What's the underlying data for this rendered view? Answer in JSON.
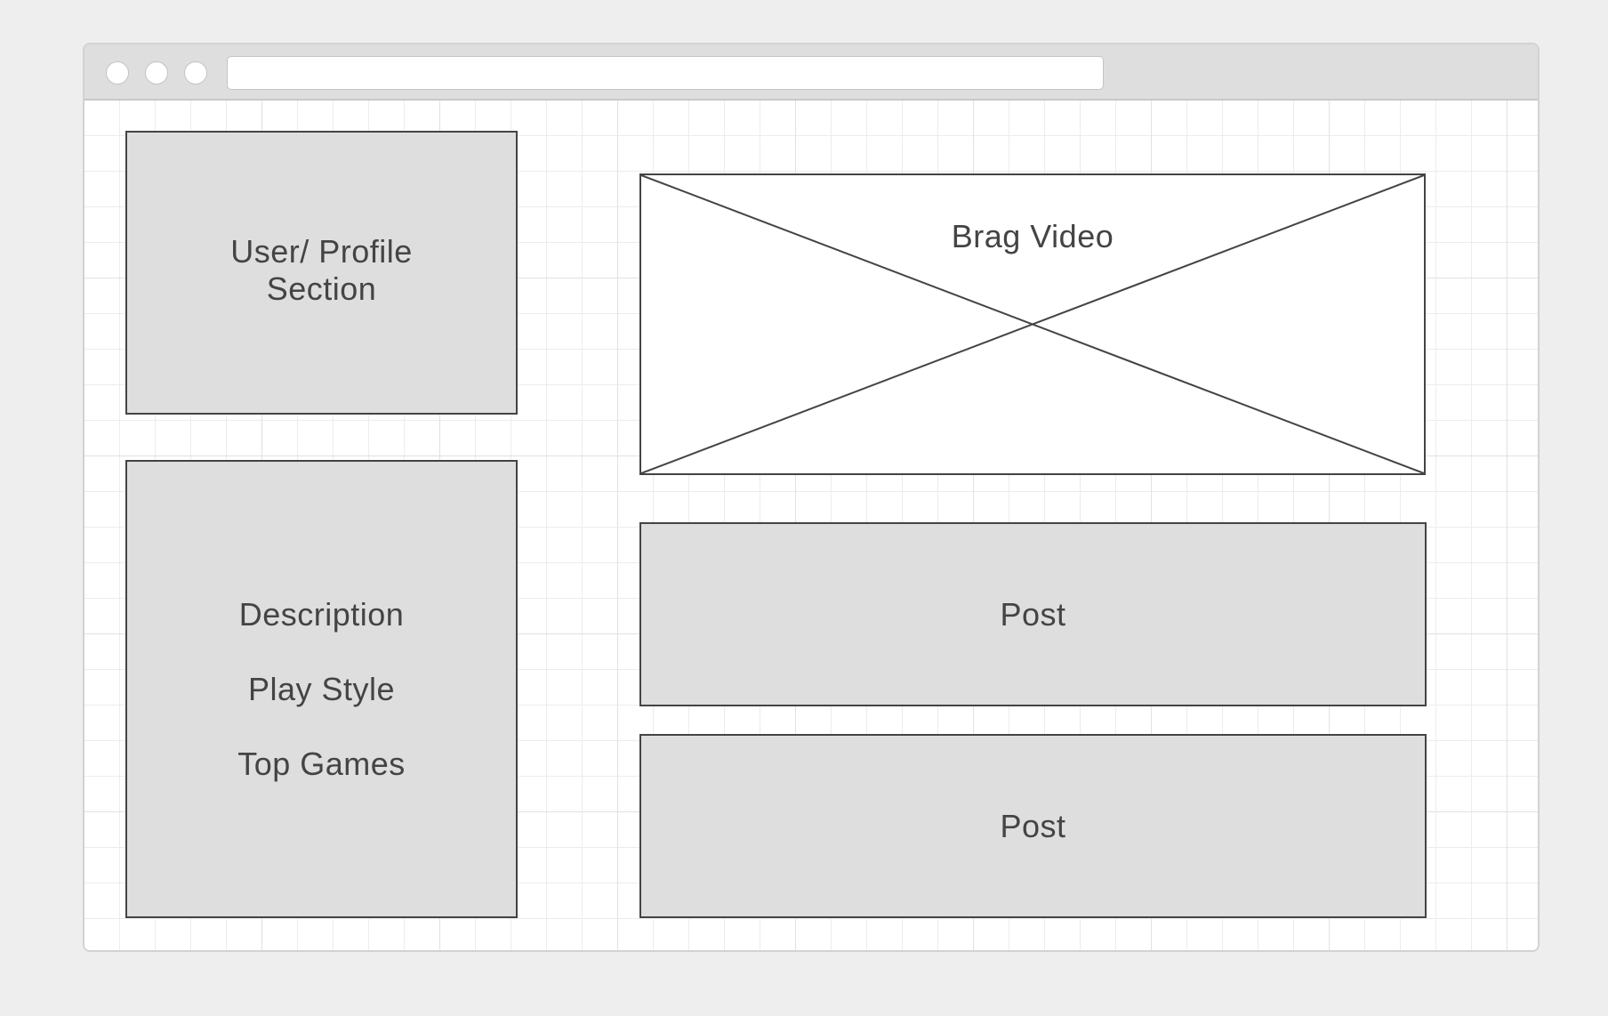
{
  "profile": {
    "label_line1": "User/ Profile",
    "label_line2": "Section"
  },
  "details": {
    "items": [
      "Description",
      "Play Style",
      "Top Games"
    ]
  },
  "video": {
    "label": "Brag Video"
  },
  "posts": [
    {
      "label": "Post"
    },
    {
      "label": "Post"
    }
  ],
  "colors": {
    "background": "#eeeeee",
    "placeholder_fill": "#dedede",
    "stroke": "#444444",
    "canvas": "#ffffff"
  }
}
